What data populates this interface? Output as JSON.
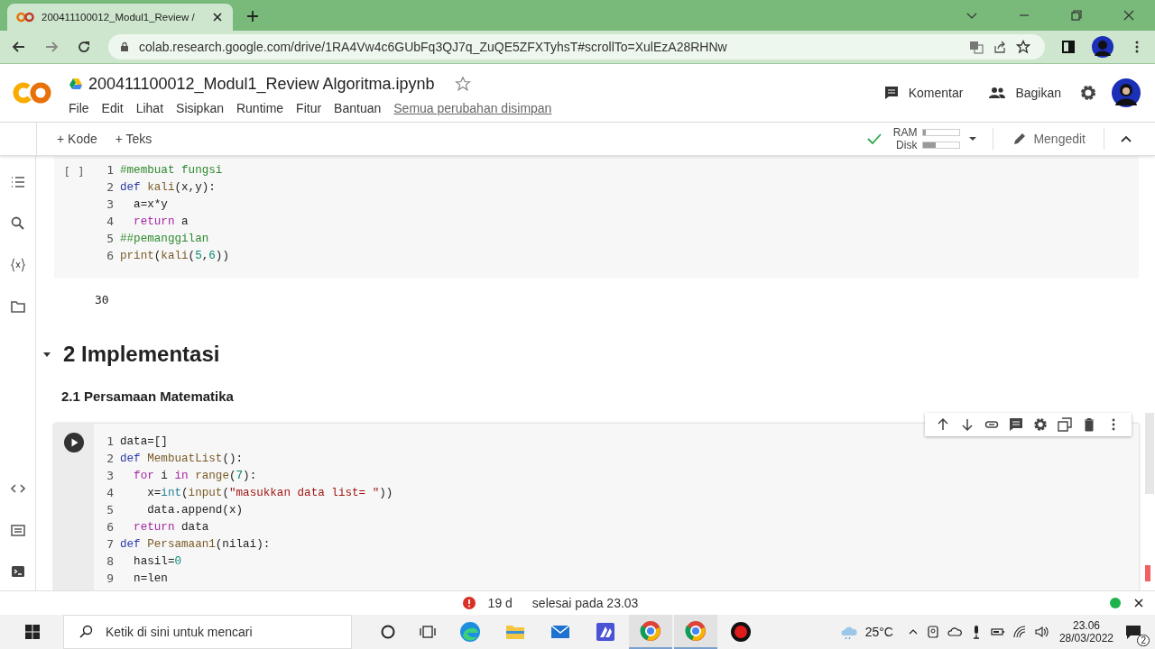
{
  "browser": {
    "tab_title": "200411100012_Modul1_Review /",
    "url": "colab.research.google.com/drive/1RA4Vw4c6GUbFq3QJ7q_ZuQE5ZFXTyhsT#scrollTo=XulEzA28RHNw"
  },
  "notebook": {
    "title": "200411100012_Modul1_Review Algoritma.ipynb",
    "starred": false,
    "menu": [
      "File",
      "Edit",
      "Lihat",
      "Sisipkan",
      "Runtime",
      "Fitur",
      "Bantuan"
    ],
    "save_status": "Semua perubahan disimpan",
    "comment_label": "Komentar",
    "share_label": "Bagikan"
  },
  "toolbar": {
    "add_buttons": [
      "+ Kode",
      "+ Teks"
    ],
    "connected": true,
    "resources": [
      {
        "label": "RAM",
        "level": 0.06
      },
      {
        "label": "Disk",
        "level": 0.35
      }
    ],
    "mode": "Mengedit"
  },
  "cells": [
    {
      "kind": "code",
      "run_label": "[ ]",
      "focused": false,
      "lines": [
        {
          "number": "1",
          "tokens": [
            {
              "kind": "comment",
              "text": "#membuat fungsi"
            }
          ]
        },
        {
          "number": "2",
          "tokens": [
            {
              "kind": "keyword",
              "text": "def "
            },
            {
              "kind": "function",
              "text": "kali"
            },
            {
              "kind": "plain",
              "text": "(x,y):"
            }
          ]
        },
        {
          "number": "3",
          "tokens": [
            {
              "kind": "plain",
              "text": "  a=x*y"
            }
          ]
        },
        {
          "number": "4",
          "tokens": [
            {
              "kind": "control",
              "text": "  return"
            },
            {
              "kind": "plain",
              "text": " a"
            }
          ]
        },
        {
          "number": "5",
          "tokens": [
            {
              "kind": "comment",
              "text": "##pemanggilan"
            }
          ]
        },
        {
          "number": "6",
          "tokens": [
            {
              "kind": "function",
              "text": "print"
            },
            {
              "kind": "plain",
              "text": "("
            },
            {
              "kind": "function",
              "text": "kali"
            },
            {
              "kind": "plain",
              "text": "("
            },
            {
              "kind": "number",
              "text": "5"
            },
            {
              "kind": "plain",
              "text": ","
            },
            {
              "kind": "number",
              "text": "6"
            },
            {
              "kind": "plain",
              "text": "))"
            }
          ]
        }
      ],
      "output": "30"
    },
    {
      "kind": "heading",
      "text": "2 Implementasi",
      "expanded": true
    },
    {
      "kind": "subheading",
      "text": "2.1 Persamaan Matematika"
    },
    {
      "kind": "code",
      "focused": true,
      "lines": [
        {
          "number": "1",
          "tokens": [
            {
              "kind": "plain",
              "text": "data=[]"
            }
          ]
        },
        {
          "number": "2",
          "tokens": [
            {
              "kind": "keyword",
              "text": "def "
            },
            {
              "kind": "function",
              "text": "MembuatList"
            },
            {
              "kind": "plain",
              "text": "():"
            }
          ]
        },
        {
          "number": "3",
          "tokens": [
            {
              "kind": "control",
              "text": "  for"
            },
            {
              "kind": "plain",
              "text": " i "
            },
            {
              "kind": "control",
              "text": "in "
            },
            {
              "kind": "function",
              "text": "range"
            },
            {
              "kind": "plain",
              "text": "("
            },
            {
              "kind": "number",
              "text": "7"
            },
            {
              "kind": "plain",
              "text": "):"
            }
          ]
        },
        {
          "number": "4",
          "tokens": [
            {
              "kind": "plain",
              "text": "    x="
            },
            {
              "kind": "type",
              "text": "int"
            },
            {
              "kind": "plain",
              "text": "("
            },
            {
              "kind": "function",
              "text": "input"
            },
            {
              "kind": "plain",
              "text": "("
            },
            {
              "kind": "string",
              "text": "\"masukkan data list= \""
            },
            {
              "kind": "plain",
              "text": "))"
            }
          ]
        },
        {
          "number": "5",
          "tokens": [
            {
              "kind": "plain",
              "text": "    data.append(x)"
            }
          ]
        },
        {
          "number": "6",
          "tokens": [
            {
              "kind": "control",
              "text": "  return"
            },
            {
              "kind": "plain",
              "text": " data"
            }
          ]
        },
        {
          "number": "7",
          "tokens": [
            {
              "kind": "keyword",
              "text": "def "
            },
            {
              "kind": "function",
              "text": "Persamaan1"
            },
            {
              "kind": "plain",
              "text": "(nilai):"
            }
          ]
        },
        {
          "number": "8",
          "tokens": [
            {
              "kind": "plain",
              "text": "  hasil="
            },
            {
              "kind": "number",
              "text": "0"
            }
          ]
        },
        {
          "number": "9",
          "tokens": [
            {
              "kind": "plain",
              "text": "  n=len"
            }
          ]
        }
      ]
    }
  ],
  "status_bar": {
    "error_count": "19 d",
    "message": "selesai pada 23.03"
  },
  "taskbar": {
    "search_placeholder": "Ketik di sini untuk mencari",
    "temperature": "25°C",
    "time": "23.06",
    "date": "28/03/2022",
    "notifications": "2"
  }
}
